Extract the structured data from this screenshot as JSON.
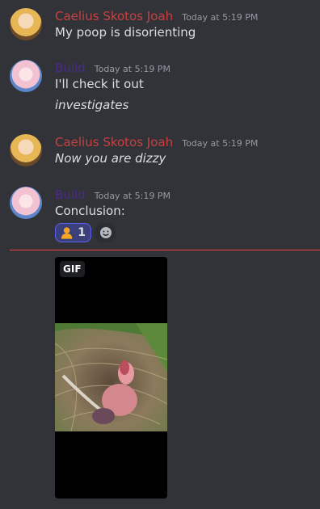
{
  "messages": [
    {
      "author": "Caelius Skotos Joah",
      "time": "Today at 5:19 PM",
      "lines": [
        "My poop is disorienting"
      ]
    },
    {
      "author": "Build",
      "time": "Today at 5:19 PM",
      "lines": [
        "I'll check it out",
        "investigates"
      ]
    },
    {
      "author": "Caelius Skotos Joah",
      "time": "Today at 5:19 PM",
      "lines": [
        "Now you are dizzy"
      ]
    },
    {
      "author": "Build",
      "time": "Today at 5:19 PM",
      "lines": [
        "Conclusion:"
      ]
    }
  ],
  "reaction": {
    "emoji": "person-emoji",
    "count": "1"
  },
  "attachment": {
    "badge": "GIF"
  },
  "colors": {
    "background": "#313338",
    "author_red": "#c94040",
    "author_purple": "#4a2a8a",
    "new_messages_line": "#f23f43",
    "reaction_border": "#5865f2"
  }
}
